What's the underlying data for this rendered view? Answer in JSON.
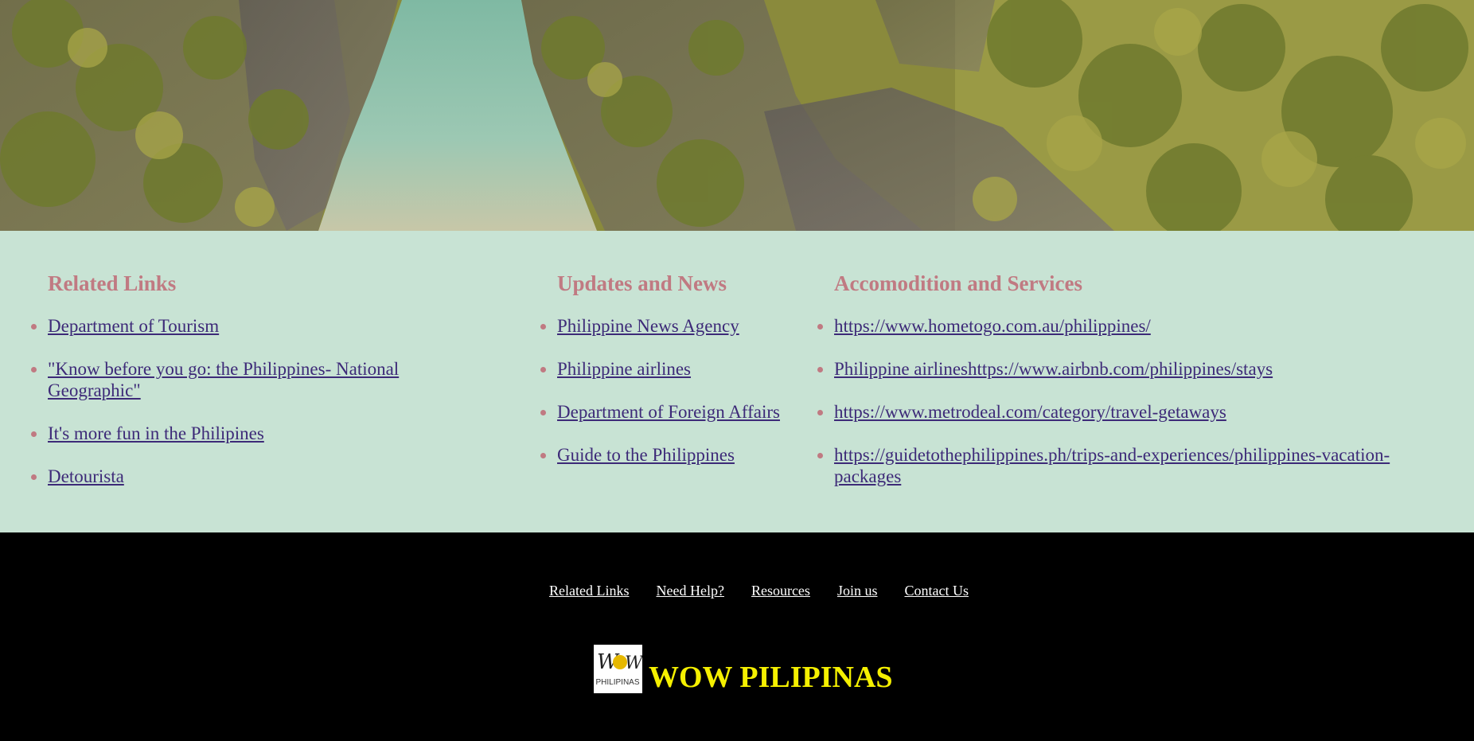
{
  "hero": {
    "image": "aerial-lagoon-photo"
  },
  "sections": {
    "related": {
      "heading": "Related Links",
      "items": [
        "Department of Tourism",
        "\"Know before you go: the Philippines- National Geographic\"",
        "It's more fun in the Philipines",
        "Detourista"
      ]
    },
    "updates": {
      "heading": "Updates and News",
      "items": [
        "Philippine News Agency",
        "Philippine airlines",
        "Department of Foreign Affairs",
        "Guide to the Philippines"
      ]
    },
    "accommodation": {
      "heading": "Accomodition and Services",
      "items": [
        "https://www.hometogo.com.au/philippines/",
        "Philippine airlineshttps://www.airbnb.com/philippines/stays",
        "https://www.metrodeal.com/category/travel-getaways",
        "https://guidetothephilippines.ph/trips-and-experiences/philippines-vacation-packages"
      ]
    }
  },
  "footer": {
    "nav": [
      "Related Links",
      "Need Help?",
      "Resources",
      "Join us",
      "Contact Us"
    ],
    "brand_name": "WOW PILIPINAS",
    "logo_text": "PHILIPINAS"
  },
  "colors": {
    "section_bg": "#c8e3d4",
    "heading": "#c07a82",
    "link": "#3d2a78",
    "footer_bg": "#000000",
    "brand": "#f5f000"
  }
}
